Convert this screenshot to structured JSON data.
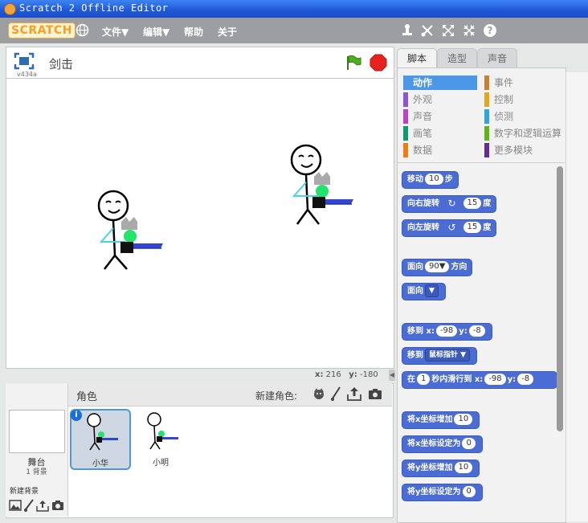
{
  "window": {
    "title": "Scratch 2 Offline Editor"
  },
  "menubar": {
    "logo": "SCRATCH",
    "items": [
      "文件▼",
      "编辑▼",
      "帮助",
      "关于"
    ]
  },
  "stage": {
    "version": "v434a",
    "project_title": "剑击",
    "mouse_x_label": "x:",
    "mouse_x": "216",
    "mouse_y_label": "y:",
    "mouse_y": "-180"
  },
  "sprites_panel": {
    "header": "角色",
    "new_sprite_label": "新建角色:",
    "stage_label": "舞台",
    "stage_sub": "1 背景",
    "new_backdrop_label": "新建背景",
    "sprites": [
      {
        "name": "小华",
        "selected": true
      },
      {
        "name": "小明",
        "selected": false
      }
    ]
  },
  "tabs": [
    {
      "label": "脚本",
      "active": true
    },
    {
      "label": "造型",
      "active": false
    },
    {
      "label": "声音",
      "active": false
    }
  ],
  "categories": [
    {
      "label": "动作",
      "color": "#4c97e6",
      "active": true
    },
    {
      "label": "事件",
      "color": "#c88330",
      "active": false
    },
    {
      "label": "外观",
      "color": "#8a55d7",
      "active": false
    },
    {
      "label": "控制",
      "color": "#e1a91a",
      "active": false
    },
    {
      "label": "声音",
      "color": "#bb42c3",
      "active": false
    },
    {
      "label": "侦测",
      "color": "#2ca5e2",
      "active": false
    },
    {
      "label": "画笔",
      "color": "#0e9a6c",
      "active": false
    },
    {
      "label": "数字和逻辑运算",
      "color": "#5cb712",
      "active": false
    },
    {
      "label": "数据",
      "color": "#ee7d16",
      "active": false
    },
    {
      "label": "更多模块",
      "color": "#632d99",
      "active": false
    }
  ],
  "blocks": {
    "move": {
      "a": "移动",
      "n": "10",
      "b": "步"
    },
    "turn_right": {
      "a": "向右旋转",
      "icon": "↻",
      "n": "15",
      "b": "度"
    },
    "turn_left": {
      "a": "向左旋转",
      "icon": "↺",
      "n": "15",
      "b": "度"
    },
    "point_dir": {
      "a": "面向",
      "n": "90▼",
      "b": "方向"
    },
    "point_towards": {
      "a": "面向",
      "n": "▼"
    },
    "goto_xy": {
      "a": "移到 x:",
      "x": "-98",
      "b": "y:",
      "y": "-8"
    },
    "goto": {
      "a": "移到",
      "n": "鼠标指针 ▼"
    },
    "glide": {
      "a": "在",
      "n": "1",
      "b": "秒内滑行到 x:",
      "x": "-98",
      "c": "y:",
      "y": "-8"
    },
    "change_x": {
      "a": "将x坐标增加",
      "n": "10"
    },
    "set_x": {
      "a": "将x坐标设定为",
      "n": "0"
    },
    "change_y": {
      "a": "将y坐标增加",
      "n": "10"
    },
    "set_y": {
      "a": "将y坐标设定为",
      "n": "0"
    }
  }
}
